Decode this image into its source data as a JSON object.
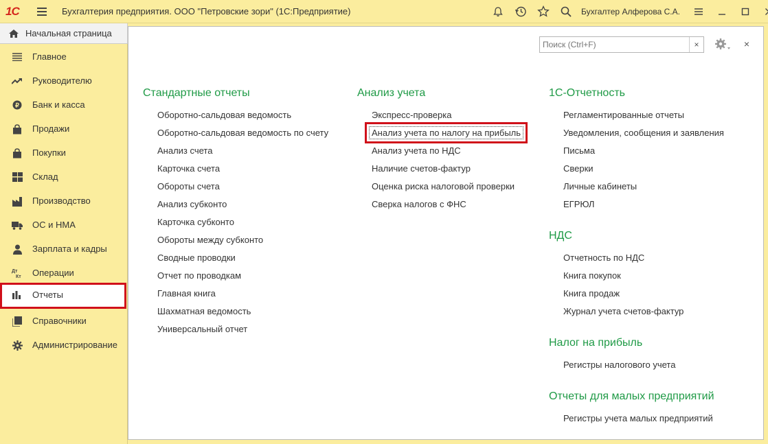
{
  "titlebar": {
    "logo": "1С",
    "app_title": "Бухгалтерия предприятия. ООО \"Петровские зори\"  (1С:Предприятие)",
    "icons": [
      "bell-icon",
      "history-icon",
      "star-icon",
      "search-icon"
    ],
    "user": "Бухгалтер Алферова С.А.",
    "window_buttons": [
      "settings-menu-icon",
      "minimize-icon",
      "maximize-icon",
      "close-icon"
    ]
  },
  "home_tab": {
    "label": "Начальная страница",
    "icon": "home-icon"
  },
  "sidebar": {
    "items": [
      {
        "label": "Главное",
        "icon": "list-icon"
      },
      {
        "label": "Руководителю",
        "icon": "trend-icon"
      },
      {
        "label": "Банк и касса",
        "icon": "coin-icon"
      },
      {
        "label": "Продажи",
        "icon": "bag-icon"
      },
      {
        "label": "Покупки",
        "icon": "cart-icon"
      },
      {
        "label": "Склад",
        "icon": "warehouse-icon"
      },
      {
        "label": "Производство",
        "icon": "factory-icon"
      },
      {
        "label": "ОС и НМА",
        "icon": "truck-icon"
      },
      {
        "label": "Зарплата и кадры",
        "icon": "person-icon"
      },
      {
        "label": "Операции",
        "icon": "dt-kt-icon"
      },
      {
        "label": "Отчеты",
        "icon": "bar-chart-icon",
        "active": true
      },
      {
        "label": "Справочники",
        "icon": "book-icon"
      },
      {
        "label": "Администрирование",
        "icon": "gear-icon"
      }
    ]
  },
  "search": {
    "placeholder": "Поиск (Ctrl+F)",
    "clear": "×"
  },
  "close_label": "×",
  "groups": {
    "standard": {
      "title": "Стандартные отчеты",
      "items": [
        "Оборотно-сальдовая ведомость",
        "Оборотно-сальдовая ведомость по счету",
        "Анализ счета",
        "Карточка счета",
        "Обороты счета",
        "Анализ субконто",
        "Карточка субконто",
        "Обороты между субконто",
        "Сводные проводки",
        "Отчет по проводкам",
        "Главная книга",
        "Шахматная ведомость",
        "Универсальный отчет"
      ]
    },
    "analysis": {
      "title": "Анализ учета",
      "items": [
        "Экспресс-проверка",
        "Анализ учета по налогу на прибыль",
        "Анализ учета по НДС",
        "Наличие счетов-фактур",
        "Оценка риска налоговой проверки",
        "Сверка налогов с ФНС"
      ],
      "highlighted_index": 1
    },
    "reporting": {
      "title": "1С-Отчетность",
      "items": [
        "Регламентированные отчеты",
        "Уведомления, сообщения и заявления",
        "Письма",
        "Сверки",
        "Личные кабинеты",
        "ЕГРЮЛ"
      ]
    },
    "vat": {
      "title": "НДС",
      "items": [
        "Отчетность по НДС",
        "Книга покупок",
        "Книга продаж",
        "Журнал учета счетов-фактур"
      ]
    },
    "profit_tax": {
      "title": "Налог на прибыль",
      "items": [
        "Регистры налогового учета"
      ]
    },
    "small_business": {
      "title": "Отчеты для малых предприятий",
      "items": [
        "Регистры учета малых предприятий"
      ]
    }
  },
  "colors": {
    "background": "#fbed9e",
    "group_title": "#1f9a46",
    "highlight": "#d0101a",
    "logo": "#d4251c"
  }
}
